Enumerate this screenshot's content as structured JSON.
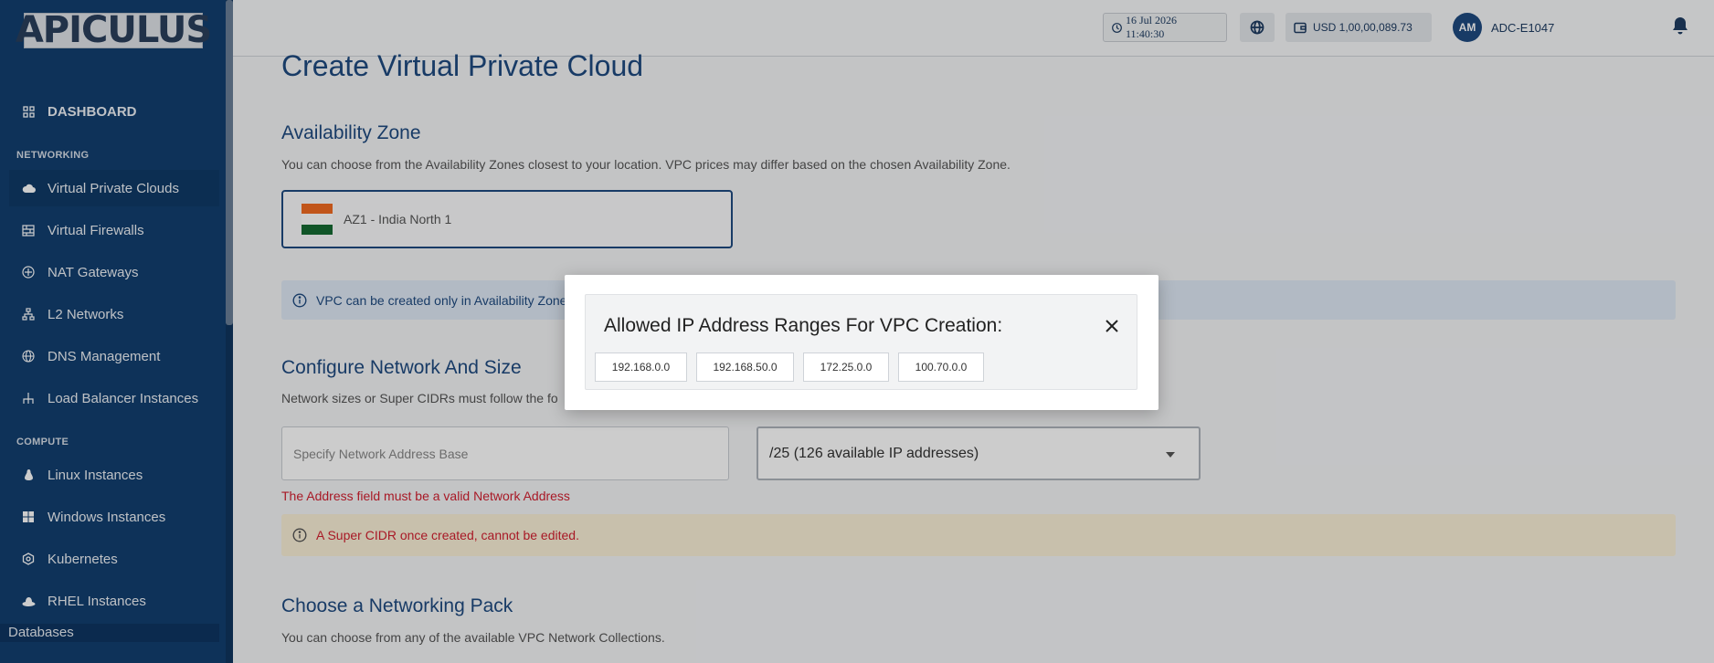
{
  "brand": {
    "logo_text": "APICULUS"
  },
  "sidebar": {
    "dashboard": "DASHBOARD",
    "sections": {
      "networking": "NETWORKING",
      "compute": "COMPUTE"
    },
    "networking_items": [
      {
        "label": "Virtual Private Clouds",
        "icon": "cloud-icon",
        "active": true
      },
      {
        "label": "Virtual Firewalls",
        "icon": "firewall-icon"
      },
      {
        "label": "NAT Gateways",
        "icon": "nat-gateway-icon"
      },
      {
        "label": "L2 Networks",
        "icon": "network-tree-icon"
      },
      {
        "label": "DNS Management",
        "icon": "globe-icon"
      },
      {
        "label": "Load Balancer Instances",
        "icon": "load-balancer-icon"
      }
    ],
    "compute_items": [
      {
        "label": "Linux Instances",
        "icon": "linux-icon"
      },
      {
        "label": "Windows Instances",
        "icon": "windows-icon"
      },
      {
        "label": "Kubernetes",
        "icon": "kubernetes-icon"
      },
      {
        "label": "RHEL Instances",
        "icon": "redhat-icon"
      }
    ],
    "databases": "Databases"
  },
  "header": {
    "datetime": "16 Jul 2026 11:40:30",
    "balance": "USD 1,00,00,089.73",
    "avatar_initials": "AM",
    "account_id": "ADC-E1047"
  },
  "main": {
    "title": "Create Virtual Private Cloud",
    "availability_zone": {
      "heading": "Availability Zone",
      "description": "You can choose from the Availability Zones closest to your location. VPC prices may differ based on the chosen Availability Zone.",
      "selected": "AZ1 - India North 1",
      "info": "VPC can be created only in Availability Zone"
    },
    "network": {
      "heading": "Configure Network And Size",
      "description": "Network sizes or Super CIDRs must follow the fo",
      "address_placeholder": "Specify Network Address Base",
      "size_selected": "/25 (126 available IP addresses)",
      "error": "The Address field must be a valid Network Address",
      "warning": "A Super CIDR once created, cannot be edited."
    },
    "pack": {
      "heading": "Choose a Networking Pack",
      "description": "You can choose from any of the available VPC Network Collections."
    }
  },
  "modal": {
    "title": "Allowed IP Address Ranges For VPC Creation:",
    "ranges": [
      "192.168.0.0",
      "192.168.50.0",
      "172.25.0.0",
      "100.70.0.0"
    ]
  },
  "colors": {
    "primary": "#1e4a80",
    "sidebar": "#123f70",
    "error": "#d32030",
    "info_bg": "#dfe9f5",
    "warn_bg": "#fbf1d7"
  }
}
